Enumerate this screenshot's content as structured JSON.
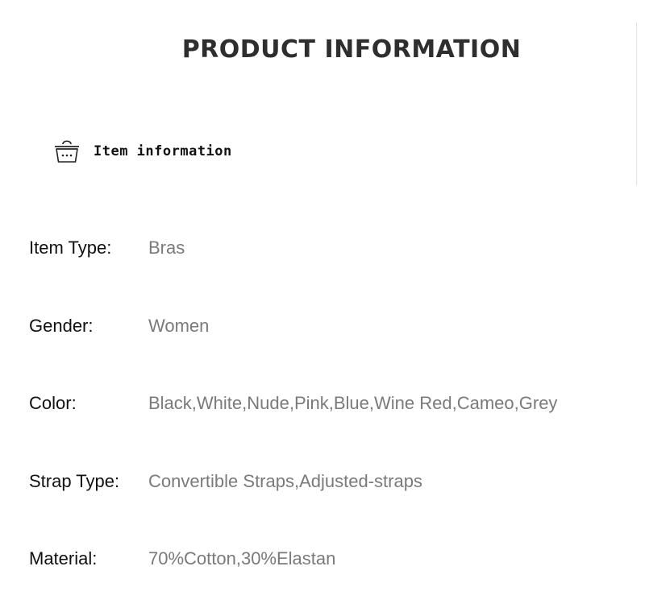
{
  "page": {
    "title": "PRODUCT INFORMATION"
  },
  "section": {
    "icon": "basket-icon",
    "label": "Item information"
  },
  "specs": [
    {
      "key": "Item Type:",
      "value": "Bras"
    },
    {
      "key": "Gender:",
      "value": "Women"
    },
    {
      "key": "Color:",
      "value": "Black,White,Nude,Pink,Blue,Wine Red,Cameo,Grey"
    },
    {
      "key": "Strap Type:",
      "value": "Convertible Straps,Adjusted-straps"
    },
    {
      "key": "Material:",
      "value": "70%Cotton,30%Elastan"
    }
  ],
  "colors": {
    "title": "#2e2e2e",
    "key_text": "#111111",
    "value_text": "#7a7a7a",
    "title_highlight": "#dce6f3"
  }
}
